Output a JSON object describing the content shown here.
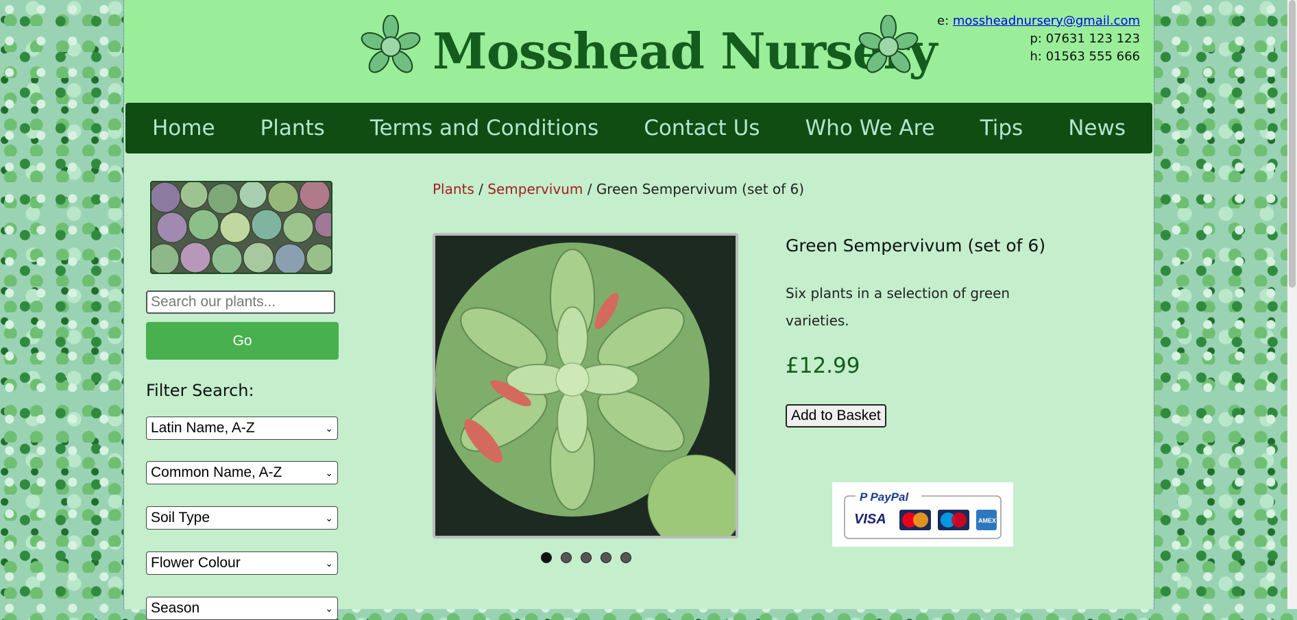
{
  "header": {
    "site_title": "Mosshead Nursery",
    "contact": {
      "email_label": "e:",
      "email": "mossheadnursery@gmail.com",
      "phone_label": "p:",
      "phone": "07631 123 123",
      "home_label": "h:",
      "home": "01563 555 666"
    }
  },
  "nav": {
    "items": [
      "Home",
      "Plants",
      "Terms and Conditions",
      "Contact Us",
      "Who We Are",
      "Tips",
      "News"
    ]
  },
  "sidebar": {
    "search_placeholder": "Search our plants...",
    "go_label": "Go",
    "filter_title": "Filter Search:",
    "filters": [
      "Latin Name, A-Z",
      "Common Name, A-Z",
      "Soil Type",
      "Flower Colour",
      "Season"
    ]
  },
  "breadcrumb": {
    "plants": "Plants",
    "sep1": " / ",
    "category": "Sempervivum",
    "sep2": " / ",
    "current": "Green Sempervivum (set of 6)"
  },
  "product": {
    "title": "Green Sempervivum (set of 6)",
    "description": "Six plants in a selection of green varieties.",
    "price": "£12.99",
    "add_to_basket": "Add to Basket",
    "carousel_active_index": 0,
    "carousel_count": 5
  },
  "payment": {
    "brand": "PayPal",
    "cards": [
      "VISA",
      "MasterCard",
      "Maestro",
      "AMEX"
    ]
  },
  "colors": {
    "header_bg": "#9aee9a",
    "nav_bg": "#0f4d12",
    "nav_text": "#b3e6d0",
    "page_bg": "#c4eecc",
    "title": "#145c1d",
    "go_button": "#48b04f",
    "link_red": "#a02020"
  }
}
